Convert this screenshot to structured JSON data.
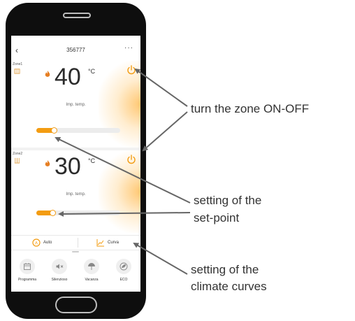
{
  "header": {
    "back_icon": "chevron-left-icon",
    "title": "356777",
    "more_icon": "more-dots-icon"
  },
  "zones": [
    {
      "label": "Zone1",
      "type_icon": "radiator-icon",
      "flame_icon": "flame-icon",
      "temperature": "40",
      "unit": "°C",
      "set_label": "Imp. temp.",
      "power_icon": "power-icon",
      "slider_fraction": 0.22
    },
    {
      "label": "Zone2",
      "type_icon": "floor-heating-icon",
      "flame_icon": "flame-icon",
      "temperature": "30",
      "unit": "°C",
      "set_label": "Imp. temp.",
      "power_icon": "power-icon",
      "slider_fraction": 0.2
    }
  ],
  "modes": {
    "auto_label": "Auto",
    "curva_label": "Curva"
  },
  "bottom_nav": [
    {
      "label": "Programma",
      "icon": "calendar-icon"
    },
    {
      "label": "Silenzioso",
      "icon": "mute-icon"
    },
    {
      "label": "Vacanza",
      "icon": "beach-umbrella-icon"
    },
    {
      "label": "ECO",
      "icon": "eco-leaf-icon"
    }
  ],
  "annotations": {
    "zone_onoff": "turn the zone ON-OFF",
    "setpoint_line1": "setting of the",
    "setpoint_line2": "set-point",
    "curves_line1": "setting of the",
    "curves_line2": "climate curves"
  },
  "colors": {
    "accent": "#f39c12",
    "text": "#2b2b2b",
    "arrow": "#666666"
  }
}
